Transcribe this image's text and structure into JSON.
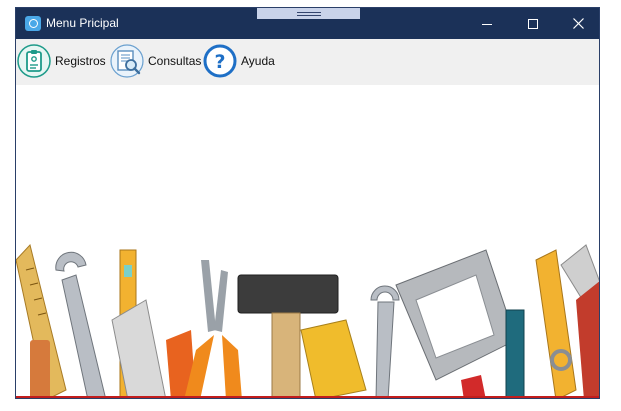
{
  "window": {
    "title": "Menu Pricipal",
    "colors": {
      "titlebar": "#1b3158",
      "menubar": "#f0f0f0",
      "accent": "#c21d1d"
    },
    "controls": {
      "minimize_icon": "minimize-icon",
      "maximize_icon": "maximize-icon",
      "close_icon": "close-icon"
    }
  },
  "menu": {
    "items": [
      {
        "label": "Registros",
        "icon": "clipboard-icon"
      },
      {
        "label": "Consultas",
        "icon": "document-search-icon"
      },
      {
        "label": "Ayuda",
        "icon": "help-icon"
      }
    ]
  },
  "content": {
    "background_image": "tools-banner"
  }
}
